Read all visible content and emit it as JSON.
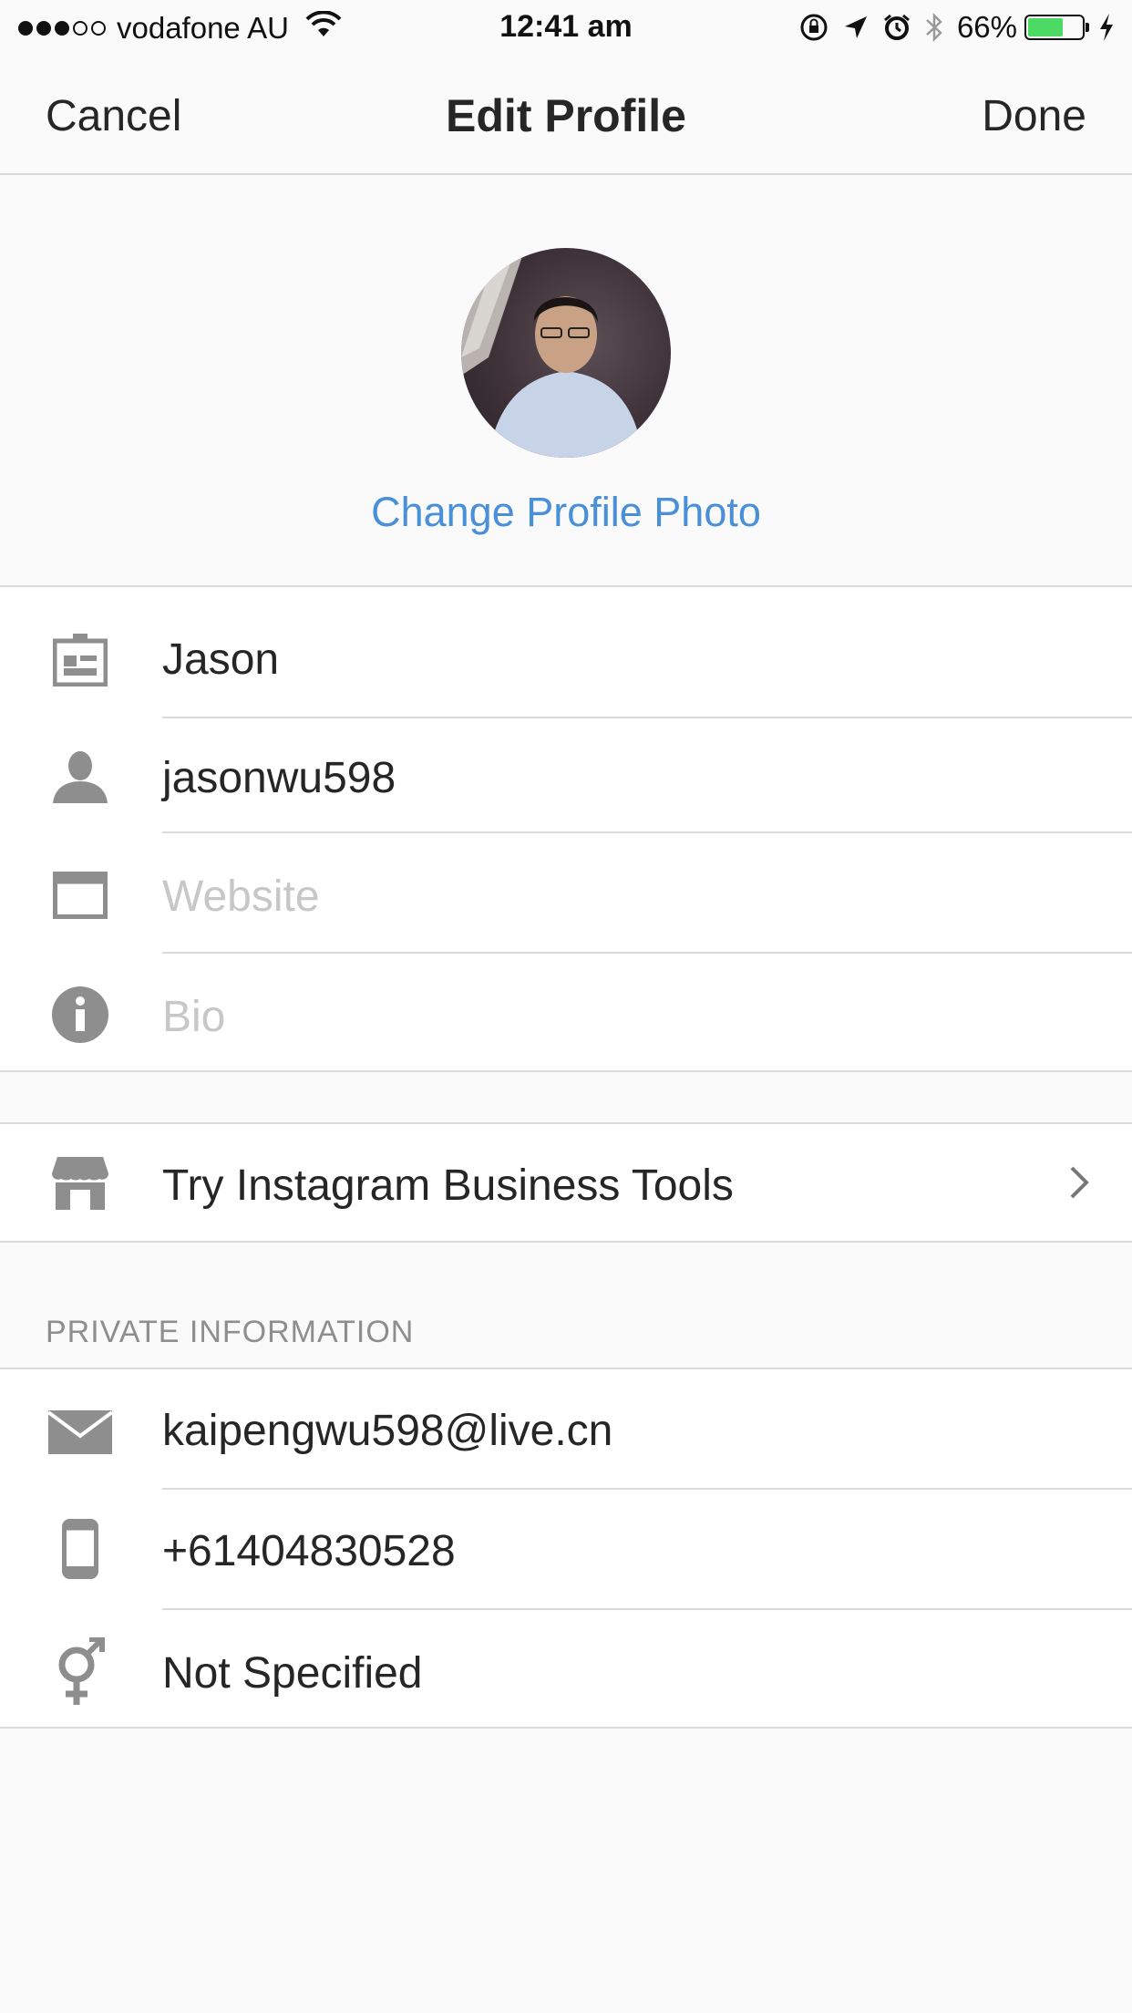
{
  "status_bar": {
    "carrier": "vodafone AU",
    "time": "12:41 am",
    "battery": "66%",
    "battery_level": 0.66,
    "signal_bars": 3,
    "icons": [
      "wifi-icon",
      "orientation-lock-icon",
      "location-icon",
      "alarm-icon",
      "bluetooth-icon",
      "charging-icon"
    ]
  },
  "nav": {
    "cancel_label": "Cancel",
    "title": "Edit Profile",
    "done_label": "Done"
  },
  "profile": {
    "change_photo_label": "Change Profile Photo"
  },
  "fields": {
    "name": "Jason",
    "username": "jasonwu598",
    "website_placeholder": "Website",
    "bio_placeholder": "Bio"
  },
  "business": {
    "label": "Try Instagram Business Tools"
  },
  "private": {
    "header": "PRIVATE INFORMATION",
    "email": "kaipengwu598@live.cn",
    "phone": "+61404830528",
    "gender": "Not Specified"
  },
  "colors": {
    "accent": "#4a90d9",
    "icon_gray": "#8e8e8e",
    "battery_green": "#4cd964"
  }
}
